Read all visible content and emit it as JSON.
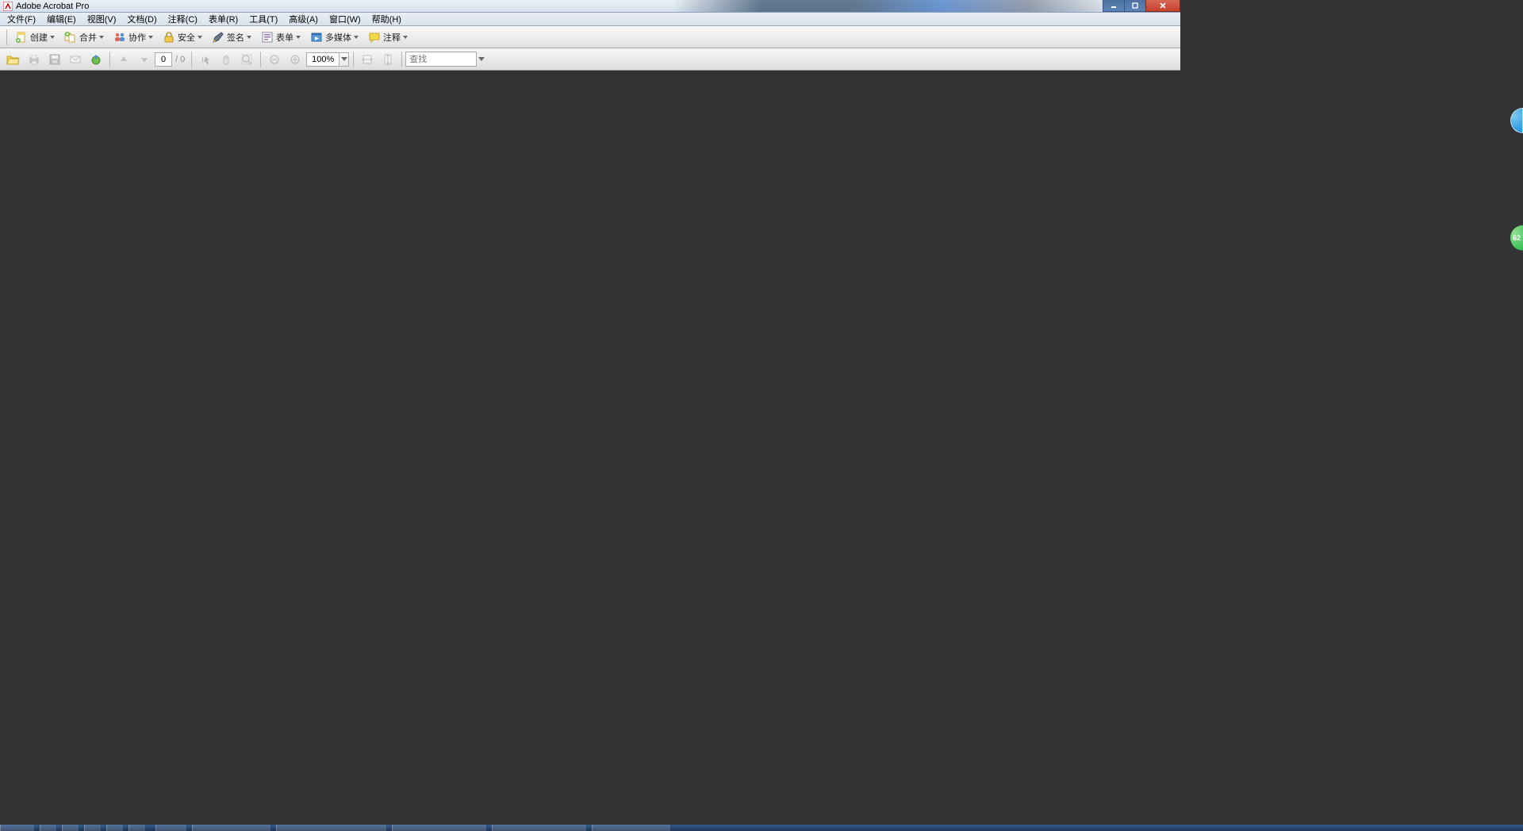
{
  "window": {
    "title": "Adobe Acrobat Pro"
  },
  "menu": {
    "items": [
      "文件(F)",
      "编辑(E)",
      "视图(V)",
      "文档(D)",
      "注释(C)",
      "表单(R)",
      "工具(T)",
      "高级(A)",
      "窗口(W)",
      "帮助(H)"
    ]
  },
  "toolbar1": {
    "create": "创建",
    "combine": "合并",
    "collaborate": "协作",
    "security": "安全",
    "sign": "签名",
    "forms": "表单",
    "multimedia": "多媒体",
    "comment": "注释"
  },
  "toolbar2": {
    "page_current": "0",
    "page_total": "/ 0",
    "zoom": "100%",
    "find_placeholder": "查找"
  },
  "float": {
    "green_text": "62"
  }
}
